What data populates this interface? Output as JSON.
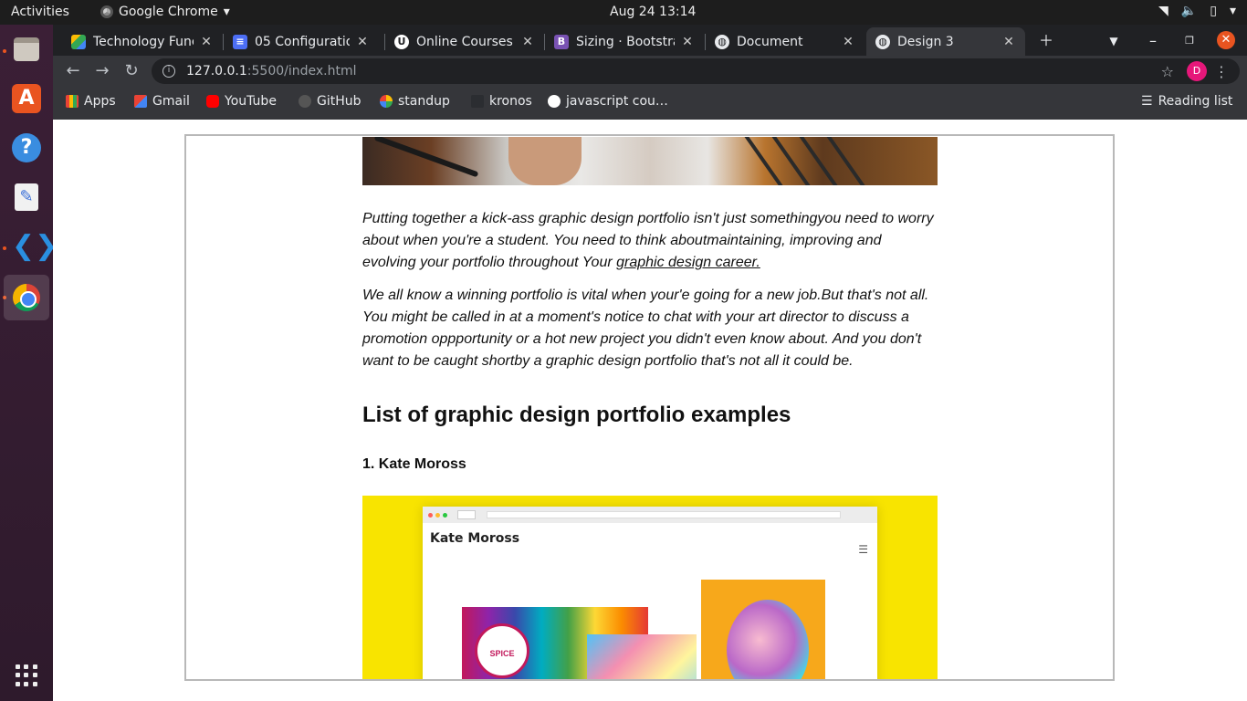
{
  "system": {
    "activities": "Activities",
    "app_menu": "Google Chrome",
    "clock": "Aug 24  13:14"
  },
  "browser": {
    "tabs": [
      {
        "title": "Technology Func",
        "icon": "google-drive-icon",
        "color": "#34a853"
      },
      {
        "title": "05 Configuratior",
        "icon": "google-docs-icon",
        "color": "#4c6ef5"
      },
      {
        "title": "Online Courses -",
        "icon": "udemy-icon",
        "color": "#ffffff"
      },
      {
        "title": "Sizing · Bootstra",
        "icon": "bootstrap-icon",
        "color": "#7952b3"
      },
      {
        "title": "Document",
        "icon": "globe-icon",
        "color": "#e8eaed"
      },
      {
        "title": "Design 3",
        "icon": "globe-icon",
        "color": "#e8eaed",
        "active": true
      }
    ],
    "url_host": "127.0.0.1",
    "url_rest": ":5500/index.html",
    "avatar_letter": "D",
    "bookmarks": [
      {
        "label": "Apps",
        "icon": "apps-grid-icon"
      },
      {
        "label": "Gmail",
        "icon": "gmail-icon"
      },
      {
        "label": "YouTube",
        "icon": "youtube-icon"
      },
      {
        "label": "GitHub",
        "icon": "github-icon"
      },
      {
        "label": "standup",
        "icon": "standup-icon"
      },
      {
        "label": "kronos",
        "icon": "kronos-icon"
      },
      {
        "label": "javascript cou…",
        "icon": "udemy-icon"
      }
    ],
    "reading_list": "Reading list"
  },
  "page": {
    "paragraph1_text": "Putting together a kick-ass graphic design portfolio isn't just somethingyou need to worry about when you're a student. You need to think aboutmaintaining, improving and evolving your portfolio throughout Your ",
    "paragraph1_link": "graphic design career.",
    "paragraph2": "We all know a winning portfolio is vital when your'e going for a new job.But that's not all. You might be called in at a moment's notice to chat with your art director to discuss a promotion oppportunity or a hot new project you didn't even know about. And you don't want to be caught shortby a graphic design portfolio that's not all it could be.",
    "heading": "List of graphic design portfolio examples",
    "subheading": "1. Kate Moross",
    "mockup_title": "Kate Moross",
    "mockup_art_text": "SPICE WORLD"
  }
}
